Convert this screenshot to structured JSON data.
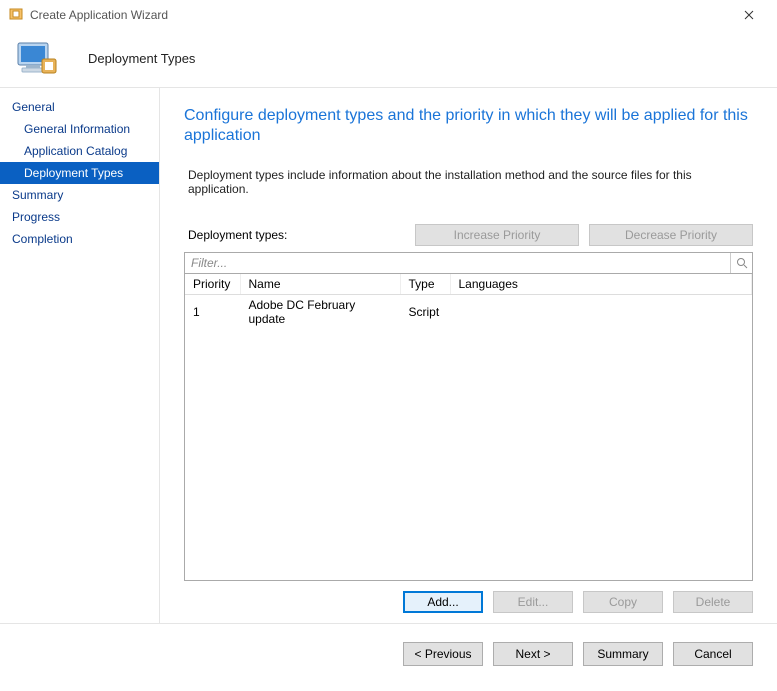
{
  "window": {
    "title": "Create Application Wizard"
  },
  "header": {
    "title": "Deployment Types"
  },
  "sidebar": {
    "items": [
      {
        "label": "General",
        "level": 1
      },
      {
        "label": "General Information",
        "level": 2
      },
      {
        "label": "Application Catalog",
        "level": 2
      },
      {
        "label": "Deployment Types",
        "level": 2,
        "active": true
      },
      {
        "label": "Summary",
        "level": 1
      },
      {
        "label": "Progress",
        "level": 1
      },
      {
        "label": "Completion",
        "level": 1
      }
    ]
  },
  "main": {
    "title": "Configure deployment types and the priority in which they will be applied for this application",
    "description": "Deployment types include information about the installation method and the source files for this application.",
    "dt_label": "Deployment types:",
    "increase_btn": "Increase Priority",
    "decrease_btn": "Decrease Priority",
    "filter_placeholder": "Filter...",
    "columns": {
      "priority": "Priority",
      "name": "Name",
      "type": "Type",
      "languages": "Languages"
    },
    "rows": [
      {
        "priority": "1",
        "name": "Adobe DC February update",
        "type": "Script",
        "languages": ""
      }
    ],
    "buttons": {
      "add": "Add...",
      "edit": "Edit...",
      "copy": "Copy",
      "delete": "Delete"
    }
  },
  "footer": {
    "previous": "< Previous",
    "next": "Next >",
    "summary": "Summary",
    "cancel": "Cancel"
  }
}
